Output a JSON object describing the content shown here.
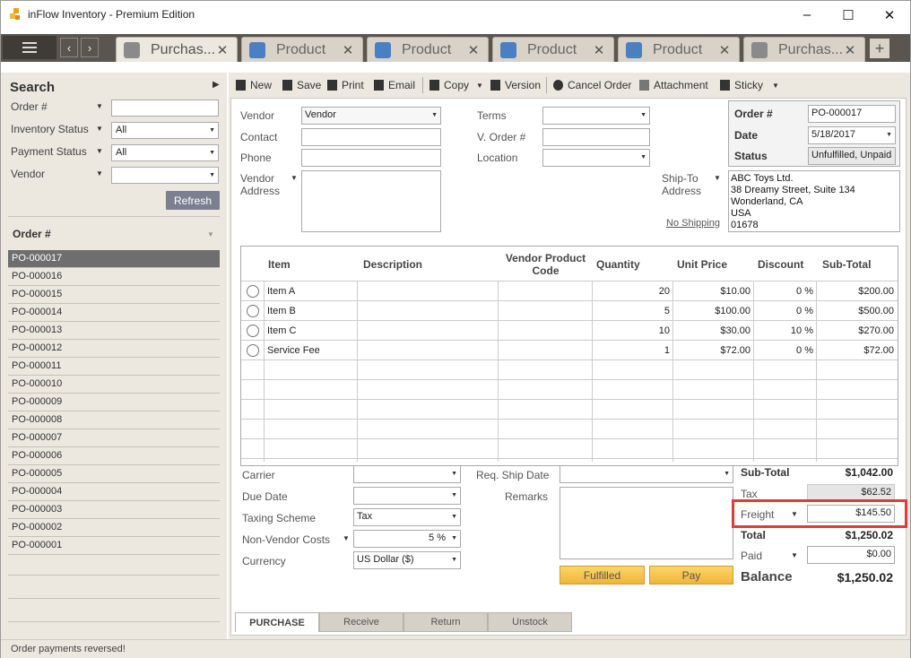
{
  "window": {
    "title": "inFlow Inventory - Premium Edition",
    "minimize": "–",
    "maximize": "☐",
    "close": "✕"
  },
  "tabs": [
    {
      "label": "Purchas...",
      "icon": "purchase-order-icon",
      "active": true
    },
    {
      "label": "Product",
      "icon": "product-icon",
      "active": false
    },
    {
      "label": "Product",
      "icon": "product-icon",
      "active": false
    },
    {
      "label": "Product",
      "icon": "product-icon",
      "active": false
    },
    {
      "label": "Product",
      "icon": "product-icon",
      "active": false
    },
    {
      "label": "Purchas...",
      "icon": "purchase-order-icon",
      "active": false
    }
  ],
  "tab_close": "✕",
  "new_tab": "+",
  "nav": {
    "back": "‹",
    "forward": "›"
  },
  "search": {
    "title": "Search",
    "order_label": "Order #",
    "order_value": "",
    "inventory_status_label": "Inventory Status",
    "inventory_status_value": "All",
    "payment_status_label": "Payment Status",
    "payment_status_value": "All",
    "vendor_label": "Vendor",
    "vendor_value": "",
    "refresh": "Refresh"
  },
  "order_list": {
    "header": "Order #",
    "items": [
      "PO-000017",
      "PO-000016",
      "PO-000015",
      "PO-000014",
      "PO-000013",
      "PO-000012",
      "PO-000011",
      "PO-000010",
      "PO-000009",
      "PO-000008",
      "PO-000007",
      "PO-000006",
      "PO-000005",
      "PO-000004",
      "PO-000003",
      "PO-000002",
      "PO-000001"
    ],
    "selected": "PO-000017"
  },
  "status_bar": "Order payments reversed!",
  "toolbar": {
    "new": "New",
    "save": "Save",
    "print": "Print",
    "email": "Email",
    "copy": "Copy",
    "version": "Version",
    "cancel_order": "Cancel Order",
    "attachment": "Attachment",
    "sticky": "Sticky"
  },
  "header": {
    "vendor_label": "Vendor",
    "vendor_value": "Vendor",
    "contact_label": "Contact",
    "contact_value": "",
    "phone_label": "Phone",
    "phone_value": "",
    "vendor_address_label_1": "Vendor",
    "vendor_address_label_2": "Address",
    "vendor_address_value": "",
    "terms_label": "Terms",
    "terms_value": "",
    "v_order_label": "V. Order #",
    "v_order_value": "",
    "location_label": "Location",
    "location_value": "",
    "order_no_label": "Order #",
    "order_no_value": "PO-000017",
    "date_label": "Date",
    "date_value": "5/18/2017",
    "status_label": "Status",
    "status_value": "Unfulfilled, Unpaid",
    "ship_to_label_1": "Ship-To",
    "ship_to_label_2": "Address",
    "no_shipping": "No Shipping",
    "ship_to_address": [
      "ABC Toys Ltd.",
      "38 Dreamy Street, Suite 134",
      "Wonderland, CA",
      "USA",
      "01678"
    ]
  },
  "grid": {
    "columns": [
      "Item",
      "Description",
      "Vendor Product Code",
      "Quantity",
      "Unit Price",
      "Discount",
      "Sub-Total"
    ],
    "rows": [
      {
        "item": "Item A",
        "description": "",
        "vendor_code": "",
        "quantity": "20",
        "unit_price": "$10.00",
        "discount": "0 %",
        "subtotal": "$200.00"
      },
      {
        "item": "Item B",
        "description": "",
        "vendor_code": "",
        "quantity": "5",
        "unit_price": "$100.00",
        "discount": "0 %",
        "subtotal": "$500.00"
      },
      {
        "item": "Item C",
        "description": "",
        "vendor_code": "",
        "quantity": "10",
        "unit_price": "$30.00",
        "discount": "10 %",
        "subtotal": "$270.00"
      },
      {
        "item": "Service Fee",
        "description": "",
        "vendor_code": "",
        "quantity": "1",
        "unit_price": "$72.00",
        "discount": "0 %",
        "subtotal": "$72.00"
      }
    ]
  },
  "footer": {
    "carrier_label": "Carrier",
    "carrier_value": "",
    "due_date_label": "Due Date",
    "due_date_value": "",
    "taxing_scheme_label": "Taxing Scheme",
    "taxing_scheme_value": "Tax",
    "non_vendor_costs_label": "Non-Vendor Costs",
    "non_vendor_costs_value": "5 %",
    "currency_label": "Currency",
    "currency_value": "US Dollar  ($)",
    "req_ship_date_label": "Req. Ship Date",
    "req_ship_date_value": "",
    "remarks_label": "Remarks",
    "remarks_value": "",
    "fulfilled_button": "Fulfilled",
    "pay_button": "Pay"
  },
  "totals": {
    "subtotal_label": "Sub-Total",
    "subtotal_value": "$1,042.00",
    "tax_label": "Tax",
    "tax_value": "$62.52",
    "freight_label": "Freight",
    "freight_value": "$145.50",
    "total_label": "Total",
    "total_value": "$1,250.02",
    "paid_label": "Paid",
    "paid_value": "$0.00",
    "balance_label": "Balance",
    "balance_value": "$1,250.02"
  },
  "bottom_tabs": [
    {
      "label": "PURCHASE",
      "active": true
    },
    {
      "label": "Receive",
      "active": false
    },
    {
      "label": "Return",
      "active": false
    },
    {
      "label": "Unstock",
      "active": false
    }
  ],
  "colors": {
    "accent_orange": "#f0b53a",
    "highlight_red": "#e03a3a",
    "selected_row": "#6e6e6e",
    "tab_strip": "#5a554f",
    "panel_bg": "#ece7df",
    "po_tab_icon": "#8a8a8a",
    "product_tab_icon": "#4b7fc4"
  }
}
